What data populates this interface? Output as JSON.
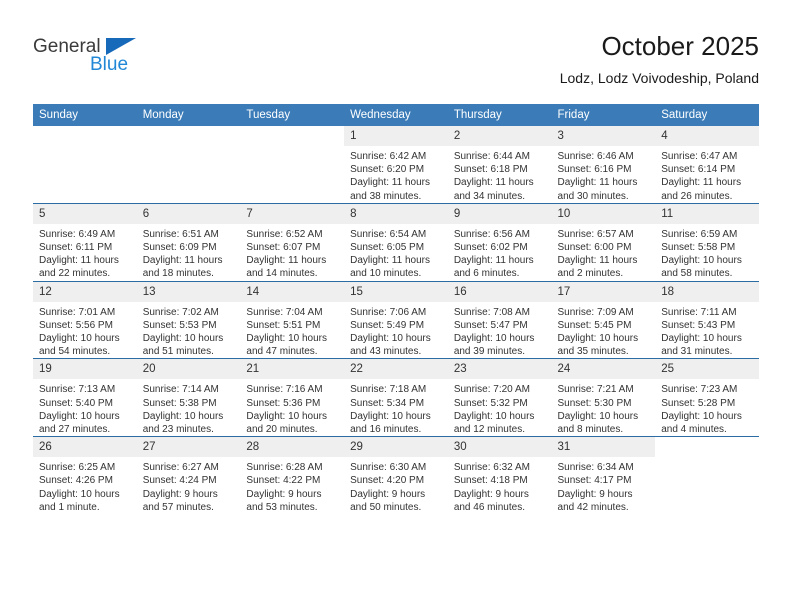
{
  "branding": {
    "logo_text_primary": "General",
    "logo_text_secondary": "Blue",
    "logo_primary_color": "#3b3b3b",
    "logo_secondary_color": "#2288d6",
    "logo_triangle_color": "#1769ba"
  },
  "header": {
    "title": "October 2025",
    "subtitle": "Lodz, Lodz Voivodeship, Poland"
  },
  "theme": {
    "header_bg": "#3b7cb8",
    "header_text": "#ffffff",
    "row_divider": "#2b6ca3",
    "daynum_bg": "#efefef",
    "cell_bg": "#ffffff",
    "body_text": "#333333"
  },
  "columns": [
    "Sunday",
    "Monday",
    "Tuesday",
    "Wednesday",
    "Thursday",
    "Friday",
    "Saturday"
  ],
  "weeks": [
    [
      {
        "day": "",
        "lines": []
      },
      {
        "day": "",
        "lines": []
      },
      {
        "day": "",
        "lines": []
      },
      {
        "day": "1",
        "lines": [
          "Sunrise: 6:42 AM",
          "Sunset: 6:20 PM",
          "Daylight: 11 hours",
          "and 38 minutes."
        ]
      },
      {
        "day": "2",
        "lines": [
          "Sunrise: 6:44 AM",
          "Sunset: 6:18 PM",
          "Daylight: 11 hours",
          "and 34 minutes."
        ]
      },
      {
        "day": "3",
        "lines": [
          "Sunrise: 6:46 AM",
          "Sunset: 6:16 PM",
          "Daylight: 11 hours",
          "and 30 minutes."
        ]
      },
      {
        "day": "4",
        "lines": [
          "Sunrise: 6:47 AM",
          "Sunset: 6:14 PM",
          "Daylight: 11 hours",
          "and 26 minutes."
        ]
      }
    ],
    [
      {
        "day": "5",
        "lines": [
          "Sunrise: 6:49 AM",
          "Sunset: 6:11 PM",
          "Daylight: 11 hours",
          "and 22 minutes."
        ]
      },
      {
        "day": "6",
        "lines": [
          "Sunrise: 6:51 AM",
          "Sunset: 6:09 PM",
          "Daylight: 11 hours",
          "and 18 minutes."
        ]
      },
      {
        "day": "7",
        "lines": [
          "Sunrise: 6:52 AM",
          "Sunset: 6:07 PM",
          "Daylight: 11 hours",
          "and 14 minutes."
        ]
      },
      {
        "day": "8",
        "lines": [
          "Sunrise: 6:54 AM",
          "Sunset: 6:05 PM",
          "Daylight: 11 hours",
          "and 10 minutes."
        ]
      },
      {
        "day": "9",
        "lines": [
          "Sunrise: 6:56 AM",
          "Sunset: 6:02 PM",
          "Daylight: 11 hours",
          "and 6 minutes."
        ]
      },
      {
        "day": "10",
        "lines": [
          "Sunrise: 6:57 AM",
          "Sunset: 6:00 PM",
          "Daylight: 11 hours",
          "and 2 minutes."
        ]
      },
      {
        "day": "11",
        "lines": [
          "Sunrise: 6:59 AM",
          "Sunset: 5:58 PM",
          "Daylight: 10 hours",
          "and 58 minutes."
        ]
      }
    ],
    [
      {
        "day": "12",
        "lines": [
          "Sunrise: 7:01 AM",
          "Sunset: 5:56 PM",
          "Daylight: 10 hours",
          "and 54 minutes."
        ]
      },
      {
        "day": "13",
        "lines": [
          "Sunrise: 7:02 AM",
          "Sunset: 5:53 PM",
          "Daylight: 10 hours",
          "and 51 minutes."
        ]
      },
      {
        "day": "14",
        "lines": [
          "Sunrise: 7:04 AM",
          "Sunset: 5:51 PM",
          "Daylight: 10 hours",
          "and 47 minutes."
        ]
      },
      {
        "day": "15",
        "lines": [
          "Sunrise: 7:06 AM",
          "Sunset: 5:49 PM",
          "Daylight: 10 hours",
          "and 43 minutes."
        ]
      },
      {
        "day": "16",
        "lines": [
          "Sunrise: 7:08 AM",
          "Sunset: 5:47 PM",
          "Daylight: 10 hours",
          "and 39 minutes."
        ]
      },
      {
        "day": "17",
        "lines": [
          "Sunrise: 7:09 AM",
          "Sunset: 5:45 PM",
          "Daylight: 10 hours",
          "and 35 minutes."
        ]
      },
      {
        "day": "18",
        "lines": [
          "Sunrise: 7:11 AM",
          "Sunset: 5:43 PM",
          "Daylight: 10 hours",
          "and 31 minutes."
        ]
      }
    ],
    [
      {
        "day": "19",
        "lines": [
          "Sunrise: 7:13 AM",
          "Sunset: 5:40 PM",
          "Daylight: 10 hours",
          "and 27 minutes."
        ]
      },
      {
        "day": "20",
        "lines": [
          "Sunrise: 7:14 AM",
          "Sunset: 5:38 PM",
          "Daylight: 10 hours",
          "and 23 minutes."
        ]
      },
      {
        "day": "21",
        "lines": [
          "Sunrise: 7:16 AM",
          "Sunset: 5:36 PM",
          "Daylight: 10 hours",
          "and 20 minutes."
        ]
      },
      {
        "day": "22",
        "lines": [
          "Sunrise: 7:18 AM",
          "Sunset: 5:34 PM",
          "Daylight: 10 hours",
          "and 16 minutes."
        ]
      },
      {
        "day": "23",
        "lines": [
          "Sunrise: 7:20 AM",
          "Sunset: 5:32 PM",
          "Daylight: 10 hours",
          "and 12 minutes."
        ]
      },
      {
        "day": "24",
        "lines": [
          "Sunrise: 7:21 AM",
          "Sunset: 5:30 PM",
          "Daylight: 10 hours",
          "and 8 minutes."
        ]
      },
      {
        "day": "25",
        "lines": [
          "Sunrise: 7:23 AM",
          "Sunset: 5:28 PM",
          "Daylight: 10 hours",
          "and 4 minutes."
        ]
      }
    ],
    [
      {
        "day": "26",
        "lines": [
          "Sunrise: 6:25 AM",
          "Sunset: 4:26 PM",
          "Daylight: 10 hours",
          "and 1 minute."
        ]
      },
      {
        "day": "27",
        "lines": [
          "Sunrise: 6:27 AM",
          "Sunset: 4:24 PM",
          "Daylight: 9 hours",
          "and 57 minutes."
        ]
      },
      {
        "day": "28",
        "lines": [
          "Sunrise: 6:28 AM",
          "Sunset: 4:22 PM",
          "Daylight: 9 hours",
          "and 53 minutes."
        ]
      },
      {
        "day": "29",
        "lines": [
          "Sunrise: 6:30 AM",
          "Sunset: 4:20 PM",
          "Daylight: 9 hours",
          "and 50 minutes."
        ]
      },
      {
        "day": "30",
        "lines": [
          "Sunrise: 6:32 AM",
          "Sunset: 4:18 PM",
          "Daylight: 9 hours",
          "and 46 minutes."
        ]
      },
      {
        "day": "31",
        "lines": [
          "Sunrise: 6:34 AM",
          "Sunset: 4:17 PM",
          "Daylight: 9 hours",
          "and 42 minutes."
        ]
      },
      {
        "day": "",
        "lines": []
      }
    ]
  ]
}
